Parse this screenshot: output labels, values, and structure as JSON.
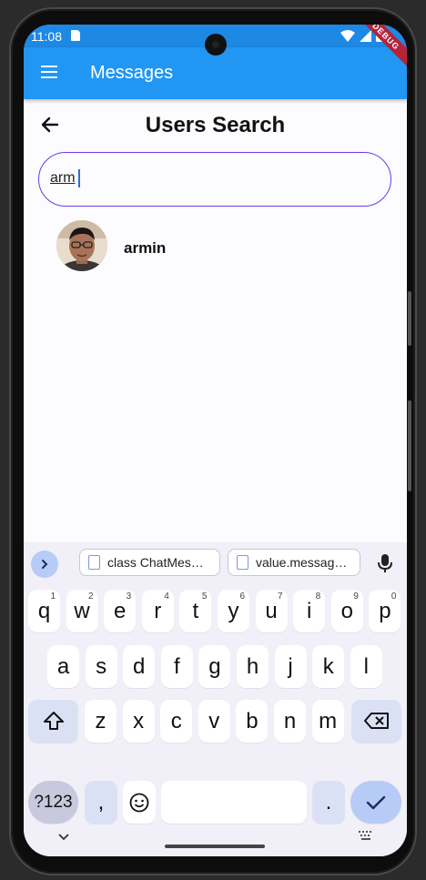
{
  "status_bar": {
    "time": "11:08",
    "debug_banner": "DEBUG"
  },
  "app_bar": {
    "title": "Messages"
  },
  "page": {
    "title": "Users Search"
  },
  "search": {
    "value": "arm",
    "placeholder": ""
  },
  "results": [
    {
      "name": "armin"
    }
  ],
  "keyboard": {
    "clipboard": [
      "class ChatMes…",
      "value.messag…"
    ],
    "row1": [
      {
        "key": "q",
        "hint": "1"
      },
      {
        "key": "w",
        "hint": "2"
      },
      {
        "key": "e",
        "hint": "3"
      },
      {
        "key": "r",
        "hint": "4"
      },
      {
        "key": "t",
        "hint": "5"
      },
      {
        "key": "y",
        "hint": "6"
      },
      {
        "key": "u",
        "hint": "7"
      },
      {
        "key": "i",
        "hint": "8"
      },
      {
        "key": "o",
        "hint": "9"
      },
      {
        "key": "p",
        "hint": "0"
      }
    ],
    "row2": [
      "a",
      "s",
      "d",
      "f",
      "g",
      "h",
      "j",
      "k",
      "l"
    ],
    "row3": [
      "z",
      "x",
      "c",
      "v",
      "b",
      "n",
      "m"
    ],
    "symbols_label": "?123",
    "comma": ",",
    "period": "."
  },
  "colors": {
    "status_bar": "#1e88e5",
    "app_bar": "#2196f3",
    "search_border": "#6a3de8",
    "enter_key": "#b7cbf7"
  }
}
